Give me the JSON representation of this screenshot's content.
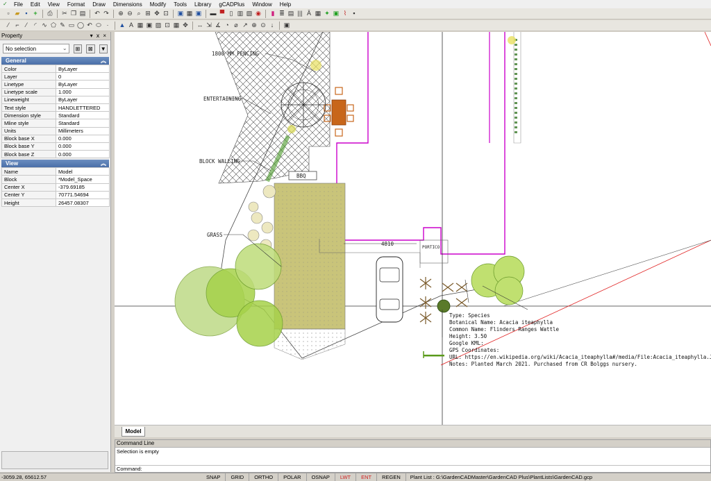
{
  "menu": {
    "items": [
      "File",
      "Edit",
      "View",
      "Format",
      "Draw",
      "Dimensions",
      "Modify",
      "Tools",
      "Library",
      "gCADPlus",
      "Window",
      "Help"
    ]
  },
  "toolbars": {
    "row1": [
      "new-icon",
      "open-icon",
      "save-icon",
      "add-icon",
      "print-icon",
      "cut-icon",
      "copy-icon",
      "paste-icon",
      "undo-icon",
      "redo-icon",
      "zoom-in-icon",
      "zoom-out-icon",
      "zoom-window-icon",
      "zoom-all-icon",
      "pan-icon",
      "layer-icon",
      "color-icon",
      "linetype-icon",
      "properties-icon",
      "palette-icon",
      "table-icon",
      "chart-icon"
    ],
    "row2": [
      "line-icon",
      "polyline-icon",
      "arc-icon",
      "circle-icon",
      "rectangle-icon",
      "polygon-icon",
      "spline-icon",
      "hatch-icon",
      "text-icon",
      "dimension-icon",
      "block-icon",
      "insert-icon",
      "move-icon",
      "rotate-icon",
      "scale-icon",
      "trim-icon",
      "extend-icon",
      "offset-icon",
      "mirror-icon",
      "fillet-icon",
      "snap-endpoint-icon",
      "snap-midpoint-icon",
      "snap-center-icon",
      "window-icon"
    ]
  },
  "property_panel": {
    "title": "Property",
    "controls": [
      "▾",
      "ⅹ",
      "×"
    ],
    "selection": "No selection",
    "general": {
      "title": "General",
      "rows": [
        {
          "k": "Color",
          "v": "ByLayer"
        },
        {
          "k": "Layer",
          "v": "0"
        },
        {
          "k": "Linetype",
          "v": "ByLayer"
        },
        {
          "k": "Linetype scale",
          "v": "1.000"
        },
        {
          "k": "Lineweight",
          "v": "ByLayer"
        },
        {
          "k": "Text style",
          "v": "HANDLETTERED"
        },
        {
          "k": "Dimension style",
          "v": "Standard"
        },
        {
          "k": "Mline style",
          "v": "Standard"
        },
        {
          "k": "Units",
          "v": "Millimeters"
        },
        {
          "k": "Block base X",
          "v": "0.000"
        },
        {
          "k": "Block base Y",
          "v": "0.000"
        },
        {
          "k": "Block base Z",
          "v": "0.000"
        }
      ]
    },
    "view": {
      "title": "View",
      "rows": [
        {
          "k": "Name",
          "v": "Model"
        },
        {
          "k": "Block",
          "v": "*Model_Space"
        },
        {
          "k": "Center X",
          "v": "-379.69185"
        },
        {
          "k": "Center Y",
          "v": "70771.54694"
        },
        {
          "k": "Height",
          "v": "26457.08307"
        }
      ]
    }
  },
  "drawing": {
    "labels": {
      "fencing": "1800 MM FENCING",
      "entertaining": "ENTERTAINING",
      "walling": "BLOCK WALLING",
      "grass": "GRASS",
      "bbq": "BBQ",
      "dimension": "4810",
      "portico": "PORTICO"
    },
    "tooltip": [
      "Type: Species",
      "Botanical Name: Acacia iteaphylla",
      "Common Name: Flinders Ranges Wattle",
      "Height: 3.50",
      "Google KML:",
      "GPS Coordinates:",
      "URL: https://en.wikipedia.org/wiki/Acacia_iteaphylla#/media/File:Acacia_iteaphylla.JPG",
      "Notes: Planted March 2021. Purchased from CR Bolggs nursery."
    ]
  },
  "tabs": {
    "model": "Model"
  },
  "command": {
    "title": "Command Line",
    "history": "Selection is empty",
    "prompt": "Command:"
  },
  "status": {
    "coords": "-3059.28,  65612.57",
    "buttons": [
      "SNAP",
      "GRID",
      "ORTHO",
      "POLAR",
      "OSNAP",
      "LWT",
      "ENT",
      "REGEN"
    ],
    "active_red": [
      "LWT",
      "ENT"
    ],
    "plant_list": "Plant List : G:\\GardenCADMaster\\GardenCAD Plus\\PlantLists\\GardenCAD.gcp"
  },
  "colors": {
    "accent_magenta": "#cc00cc",
    "grass": "#c9c47a",
    "tree_green": "#a6d24a",
    "red_line": "#e02020"
  }
}
